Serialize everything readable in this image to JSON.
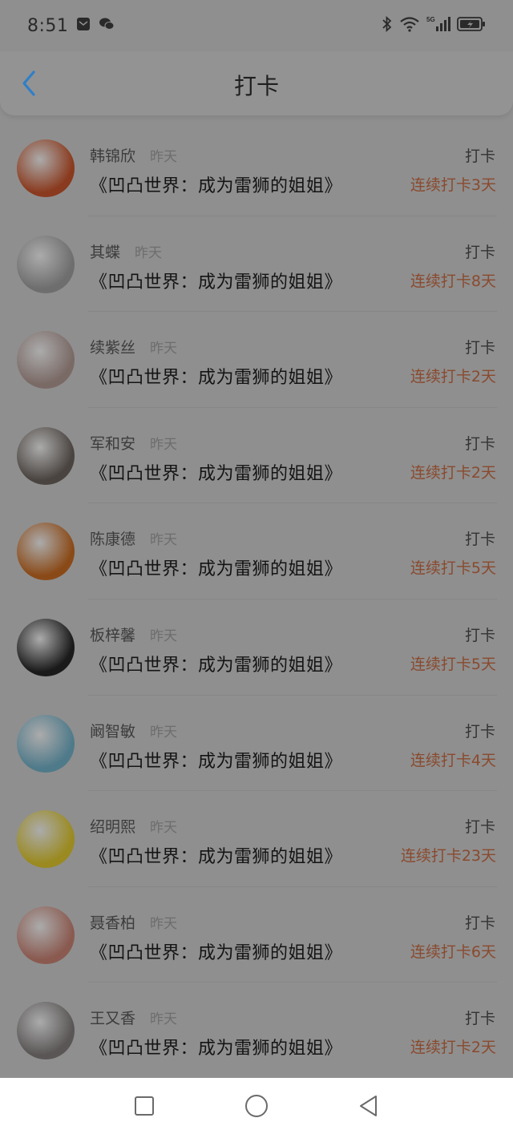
{
  "status_bar": {
    "time": "8:51",
    "icons": [
      "message-icon",
      "wechat-icon",
      "bluetooth-icon",
      "wifi-icon",
      "signal-5g-icon",
      "battery-charging-icon"
    ],
    "signal_label": "5G"
  },
  "header": {
    "title": "打卡",
    "back_icon": "chevron-left-icon",
    "accent": "#2f8fd8"
  },
  "checkins": [
    {
      "name": "韩锦欣",
      "time": "昨天",
      "book": "《凹凸世界：成为雷狮的姐姐》",
      "action": "打卡",
      "streak": "连续打卡3天"
    },
    {
      "name": "其蝶",
      "time": "昨天",
      "book": "《凹凸世界：成为雷狮的姐姐》",
      "action": "打卡",
      "streak": "连续打卡8天"
    },
    {
      "name": "续紫丝",
      "time": "昨天",
      "book": "《凹凸世界：成为雷狮的姐姐》",
      "action": "打卡",
      "streak": "连续打卡2天"
    },
    {
      "name": "军和安",
      "time": "昨天",
      "book": "《凹凸世界：成为雷狮的姐姐》",
      "action": "打卡",
      "streak": "连续打卡2天"
    },
    {
      "name": "陈康德",
      "time": "昨天",
      "book": "《凹凸世界：成为雷狮的姐姐》",
      "action": "打卡",
      "streak": "连续打卡5天"
    },
    {
      "name": "板梓馨",
      "time": "昨天",
      "book": "《凹凸世界：成为雷狮的姐姐》",
      "action": "打卡",
      "streak": "连续打卡5天"
    },
    {
      "name": "阚智敏",
      "time": "昨天",
      "book": "《凹凸世界：成为雷狮的姐姐》",
      "action": "打卡",
      "streak": "连续打卡4天"
    },
    {
      "name": "绍明熙",
      "time": "昨天",
      "book": "《凹凸世界：成为雷狮的姐姐》",
      "action": "打卡",
      "streak": "连续打卡23天"
    },
    {
      "name": "聂香柏",
      "time": "昨天",
      "book": "《凹凸世界：成为雷狮的姐姐》",
      "action": "打卡",
      "streak": "连续打卡6天"
    },
    {
      "name": "王又香",
      "time": "昨天",
      "book": "《凹凸世界：成为雷狮的姐姐》",
      "action": "打卡",
      "streak": "连续打卡2天"
    }
  ],
  "avatar_colors": [
    "#8a3a1e",
    "#6e6e6e",
    "#7a6a66",
    "#4a4440",
    "#8a4a18",
    "#1a1a1a",
    "#4f7a8a",
    "#9a8a20",
    "#8a5a50",
    "#5a5656"
  ],
  "bottom_nav": {
    "icons": [
      "recent-apps-icon",
      "home-icon",
      "back-icon"
    ]
  }
}
